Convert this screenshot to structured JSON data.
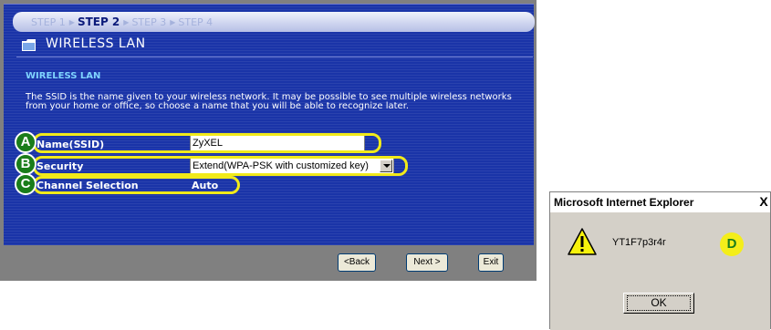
{
  "wizard": {
    "steps": [
      {
        "label": "STEP 1",
        "active": false
      },
      {
        "label": "STEP 2",
        "active": true
      },
      {
        "label": "STEP 3",
        "active": false
      },
      {
        "label": "STEP 4",
        "active": false
      }
    ],
    "page_title": "WIRELESS LAN",
    "section_heading": "WIRELESS LAN",
    "description": "The SSID is the name given to your wireless network. It may be possible to see multiple wireless networks from your home or office, so choose a name that you will be able to recognize later.",
    "fields": {
      "ssid": {
        "label": "Name(SSID)",
        "value": "ZyXEL"
      },
      "security": {
        "label": "Security",
        "value": "Extend(WPA-PSK with customized key)"
      },
      "channel": {
        "label": "Channel Selection",
        "value": "Auto"
      }
    },
    "buttons": {
      "back": "<Back",
      "next": "Next >",
      "exit": "Exit"
    }
  },
  "callouts": {
    "a": "A",
    "b": "B",
    "c": "C",
    "d": "D"
  },
  "dialog": {
    "title": "Microsoft Internet Explorer",
    "close": "X",
    "message": "YT1F7p3r4r",
    "ok": "OK",
    "icon": "warning-icon"
  },
  "colors": {
    "panel_bg": "#1a34a8",
    "section_heading": "#7fd4ff",
    "callout_ring": "#f1ea1a",
    "callout_badge": "#1a7d1a"
  }
}
